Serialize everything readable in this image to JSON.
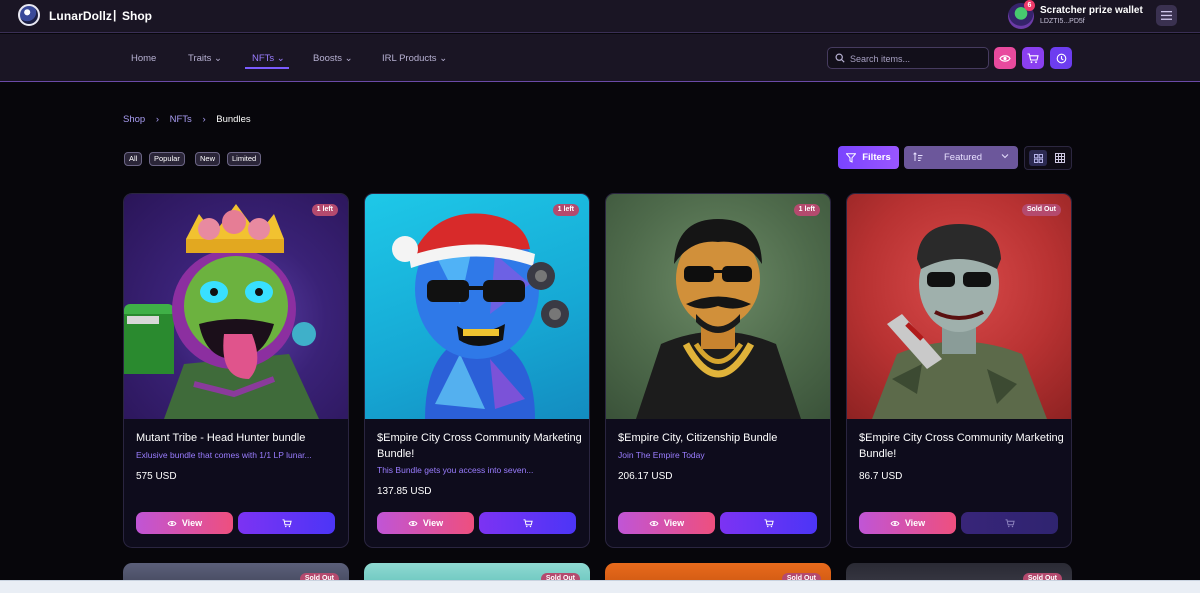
{
  "header": {
    "brand": "LunarDollz",
    "separator": "|",
    "page": "Shop",
    "wallet": {
      "name": "Scratcher prize wallet",
      "address": "LDZTI5...PD5f",
      "notification_count": "6"
    }
  },
  "nav": {
    "items": [
      {
        "label": "Home",
        "has_dropdown": false
      },
      {
        "label": "Traits ⌄",
        "has_dropdown": true
      },
      {
        "label": "NFTs ⌄",
        "has_dropdown": true,
        "active": true
      },
      {
        "label": "Boosts ⌄",
        "has_dropdown": true
      },
      {
        "label": "IRL Products ⌄",
        "has_dropdown": true
      }
    ],
    "search_placeholder": "Search items..."
  },
  "breadcrumb": {
    "items": [
      "Shop",
      "NFTs",
      "Bundles"
    ],
    "separator": "›"
  },
  "filters": {
    "tags": [
      "All",
      "Popular",
      "New",
      "Limited"
    ],
    "filters_label": "Filters",
    "sort_value": "Featured"
  },
  "products": [
    {
      "title": "Mutant Tribe - Head Hunter bundle",
      "description": "Exlusive bundle that comes with 1/1 LP lunar...",
      "price": "575 USD",
      "badge": "1 left",
      "view_label": "View",
      "sold_out": false
    },
    {
      "title": "$Empire City Cross Community Marketing Bundle!",
      "description": "This Bundle gets you access into seven...",
      "price": "137.85 USD",
      "badge": "1 left",
      "view_label": "View",
      "sold_out": false
    },
    {
      "title": "$Empire City, Citizenship Bundle",
      "description": "Join The Empire Today",
      "price": "206.17 USD",
      "badge": "1 left",
      "view_label": "View",
      "sold_out": false
    },
    {
      "title": "$Empire City Cross Community Marketing Bundle!",
      "description": "",
      "price": "86.7 USD",
      "badge": "Sold Out",
      "view_label": "View",
      "sold_out": true
    }
  ],
  "next_row_badges": [
    "Sold Out",
    "Sold Out",
    "Sold Out",
    "Sold Out"
  ],
  "colors": {
    "accent": "#7b5cff",
    "view_gradient_start": "#c055d6",
    "view_gradient_end": "#ee4f7e",
    "cart": "#5b35f5"
  }
}
